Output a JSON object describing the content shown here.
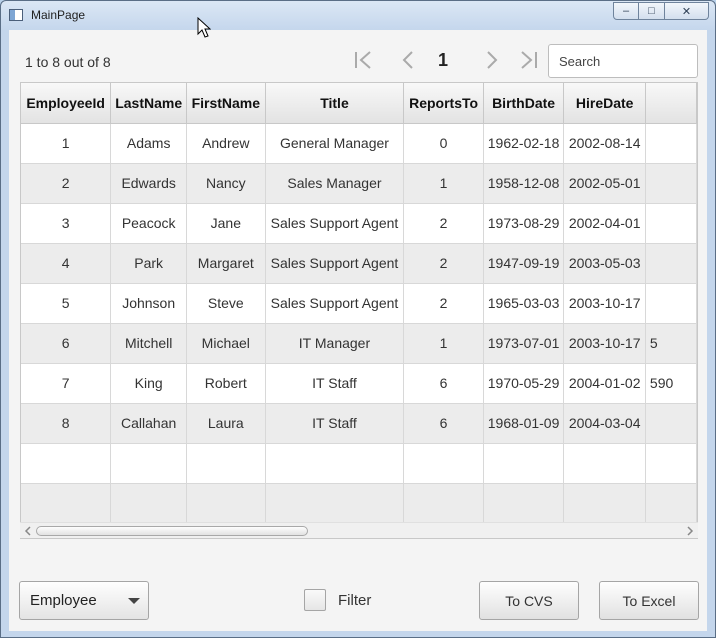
{
  "window": {
    "title": "MainPage",
    "controls": {
      "minimize": "–",
      "maximize": "□",
      "close": "✕"
    }
  },
  "toolbar": {
    "page_info": "1 to 8 out of 8",
    "current_page": "1",
    "search": {
      "placeholder": "Search",
      "value": ""
    }
  },
  "table": {
    "columns": [
      "EmployeeId",
      "LastName",
      "FirstName",
      "Title",
      "ReportsTo",
      "BirthDate",
      "HireDate",
      ""
    ],
    "rows": [
      [
        "1",
        "Adams",
        "Andrew",
        "General Manager",
        "0",
        "1962-02-18",
        "2002-08-14",
        ""
      ],
      [
        "2",
        "Edwards",
        "Nancy",
        "Sales Manager",
        "1",
        "1958-12-08",
        "2002-05-01",
        ""
      ],
      [
        "3",
        "Peacock",
        "Jane",
        "Sales Support Agent",
        "2",
        "1973-08-29",
        "2002-04-01",
        ""
      ],
      [
        "4",
        "Park",
        "Margaret",
        "Sales Support Agent",
        "2",
        "1947-09-19",
        "2003-05-03",
        ""
      ],
      [
        "5",
        "Johnson",
        "Steve",
        "Sales Support Agent",
        "2",
        "1965-03-03",
        "2003-10-17",
        ""
      ],
      [
        "6",
        "Mitchell",
        "Michael",
        "IT Manager",
        "1",
        "1973-07-01",
        "2003-10-17",
        "5"
      ],
      [
        "7",
        "King",
        "Robert",
        "IT Staff",
        "6",
        "1970-05-29",
        "2004-01-02",
        "590"
      ],
      [
        "8",
        "Callahan",
        "Laura",
        "IT Staff",
        "6",
        "1968-01-09",
        "2004-03-04",
        ""
      ],
      [
        "",
        "",
        "",
        "",
        "",
        "",
        "",
        ""
      ],
      [
        "",
        "",
        "",
        "",
        "",
        "",
        "",
        ""
      ]
    ]
  },
  "footer": {
    "entity_select": "Employee",
    "filter_label": "Filter",
    "filter_checked": false,
    "to_csv_label": "To CVS",
    "to_excel_label": "To Excel"
  },
  "icons": {
    "first": "first-page-icon",
    "prev": "previous-page-icon",
    "next": "next-page-icon",
    "last": "last-page-icon",
    "dropdown": "chevron-down-icon",
    "scroll_left": "scroll-left-icon",
    "scroll_right": "scroll-right-icon"
  }
}
